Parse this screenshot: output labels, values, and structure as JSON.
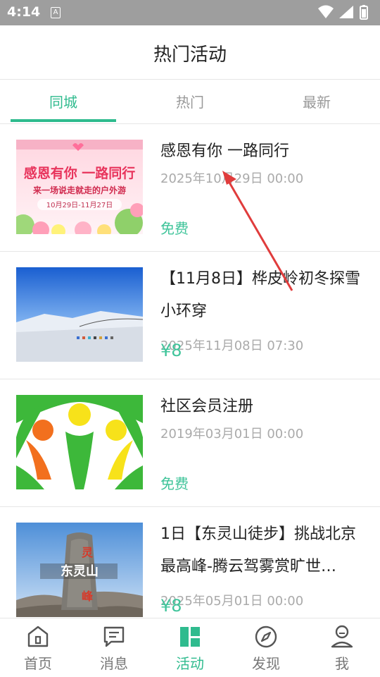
{
  "status_bar": {
    "time": "4:14",
    "a_badge": "A"
  },
  "header": {
    "title": "热门活动"
  },
  "tabs": [
    {
      "label": "同城",
      "active": true
    },
    {
      "label": "热门",
      "active": false
    },
    {
      "label": "最新",
      "active": false
    }
  ],
  "activities": [
    {
      "title": "感恩有你 一路同行",
      "date": "2025年10月29日 00:00",
      "price": "免费",
      "image_text": {
        "line1": "感恩有你 一路同行",
        "line2": "来一场说走就走的户外游",
        "line3": "10月29日-11月27日"
      }
    },
    {
      "title": "【11月8日】桦皮岭初冬探雪小环穿",
      "date": "2025年11月08日 07:30",
      "price": "¥8"
    },
    {
      "title": "社区会员注册",
      "date": "2019年03月01日 00:00",
      "price": "免费"
    },
    {
      "title": "1日【东灵山徒步】挑战北京最高峰-腾云驾雾赏旷世…",
      "date": "2025年05月01日 00:00",
      "price": "¥8",
      "image_text": {
        "sign": "东灵山"
      }
    }
  ],
  "bottom_nav": [
    {
      "label": "首页",
      "icon": "home-icon",
      "active": false
    },
    {
      "label": "消息",
      "icon": "message-icon",
      "active": false
    },
    {
      "label": "活动",
      "icon": "activity-icon",
      "active": true
    },
    {
      "label": "发现",
      "icon": "compass-icon",
      "active": false
    },
    {
      "label": "我",
      "icon": "profile-icon",
      "active": false
    }
  ],
  "colors": {
    "accent": "#2fbb8e",
    "price": "#3fc49a",
    "status_bar": "#9e9e9e",
    "annotation_arrow": "#e03c3c"
  }
}
